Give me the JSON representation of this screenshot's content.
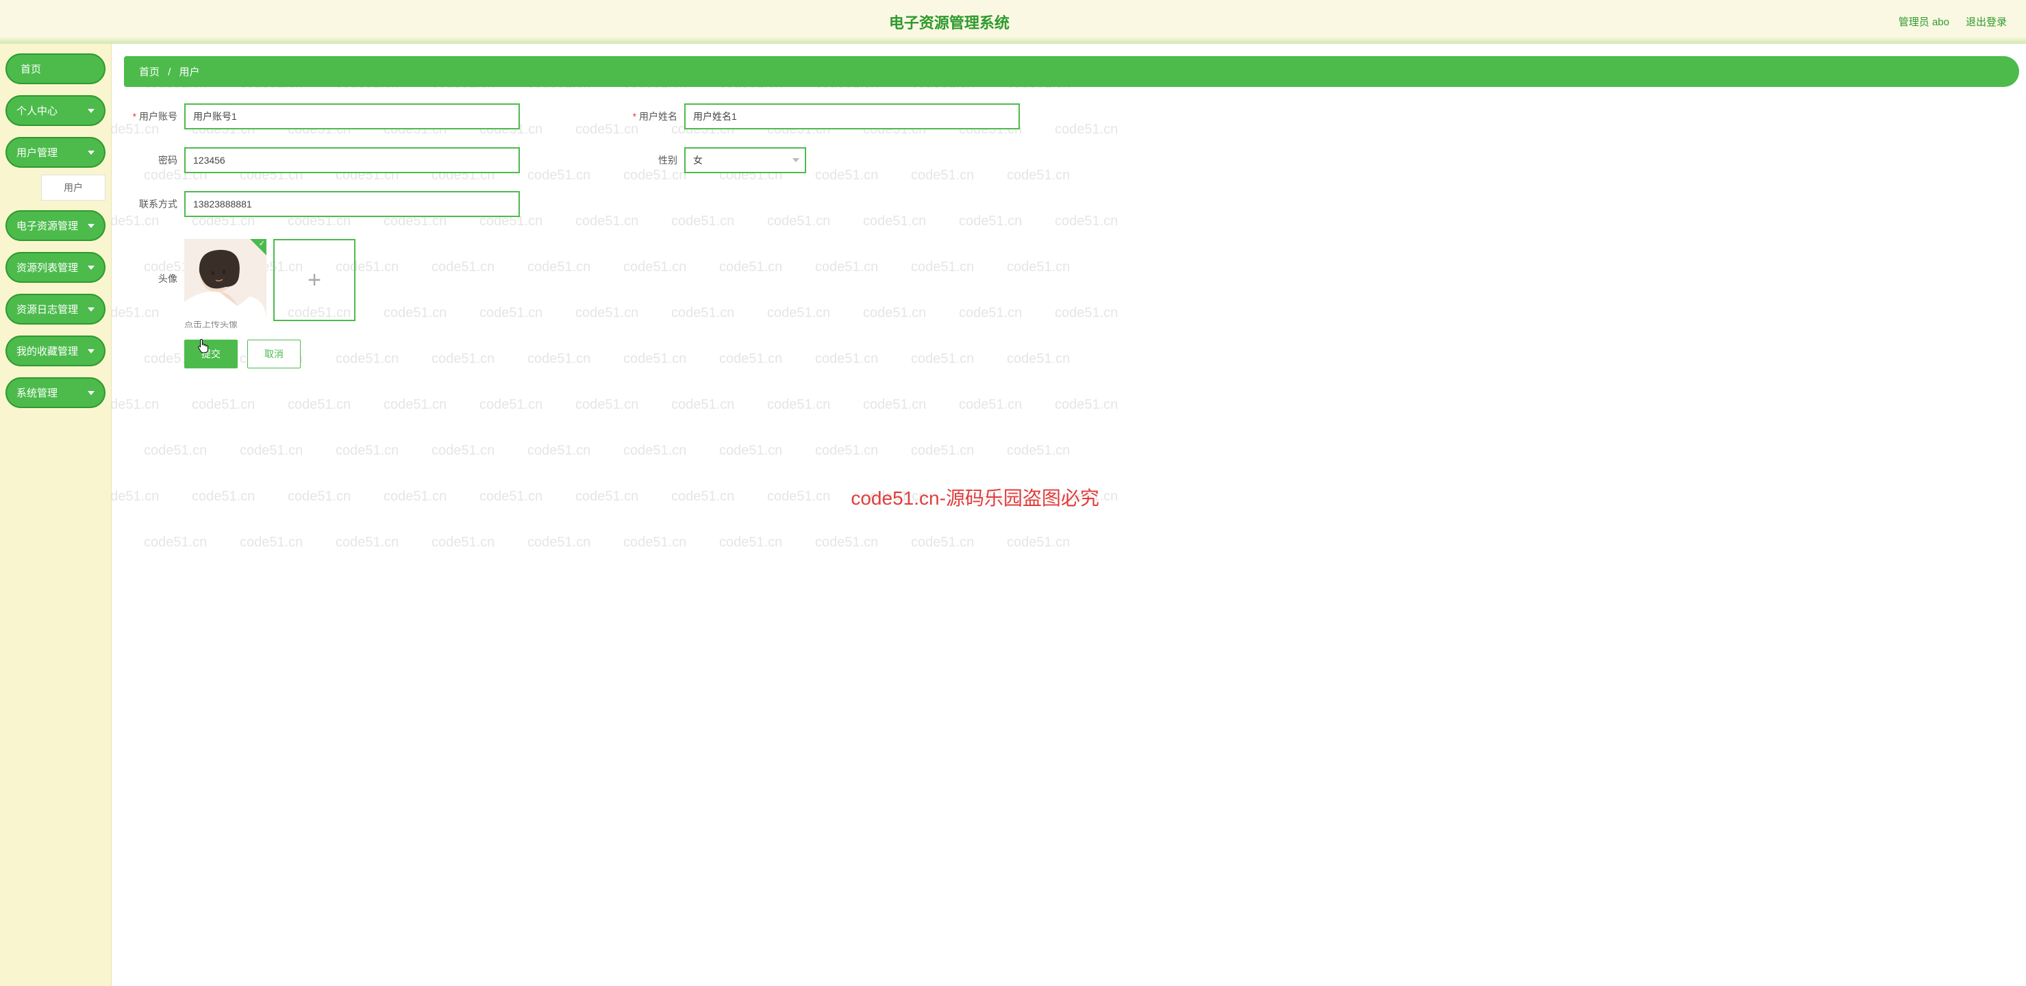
{
  "header": {
    "title": "电子资源管理系统",
    "user": "管理员 abo",
    "logout": "退出登录"
  },
  "sidebar": {
    "items": [
      {
        "label": "首页",
        "expandable": false
      },
      {
        "label": "个人中心",
        "expandable": true
      },
      {
        "label": "用户管理",
        "expandable": true,
        "sub": "用户"
      },
      {
        "label": "电子资源管理",
        "expandable": true
      },
      {
        "label": "资源列表管理",
        "expandable": true
      },
      {
        "label": "资源日志管理",
        "expandable": true
      },
      {
        "label": "我的收藏管理",
        "expandable": true
      },
      {
        "label": "系统管理",
        "expandable": true
      }
    ]
  },
  "breadcrumb": {
    "home": "首页",
    "sep": "/",
    "current": "用户"
  },
  "form": {
    "labels": {
      "account": "用户账号",
      "name": "用户姓名",
      "password": "密码",
      "gender": "性别",
      "phone": "联系方式",
      "avatar": "头像"
    },
    "values": {
      "account": "用户账号1",
      "name": "用户姓名1",
      "password": "123456",
      "gender": "女",
      "phone": "13823888881"
    },
    "upload_hint": "点击上传头像"
  },
  "buttons": {
    "submit": "提交",
    "cancel": "取消"
  },
  "watermark": {
    "text": "code51.cn",
    "center": "code51.cn-源码乐园盗图必究"
  }
}
